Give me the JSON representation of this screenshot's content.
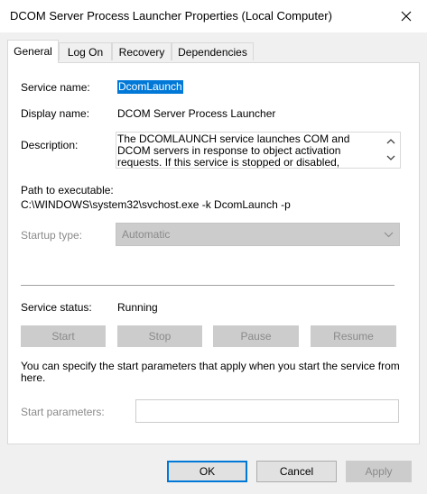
{
  "window": {
    "title": "DCOM Server Process Launcher Properties (Local Computer)",
    "close_glyph": "close-icon"
  },
  "tabs": [
    {
      "label": "General",
      "active": true
    },
    {
      "label": "Log On",
      "active": false
    },
    {
      "label": "Recovery",
      "active": false
    },
    {
      "label": "Dependencies",
      "active": false
    }
  ],
  "general": {
    "service_name_label": "Service name:",
    "service_name": "DcomLaunch",
    "display_name_label": "Display name:",
    "display_name": "DCOM Server Process Launcher",
    "description_label": "Description:",
    "description": "The DCOMLAUNCH service launches COM and DCOM servers in response to object activation requests. If this service is stopped or disabled,",
    "path_label": "Path to executable:",
    "path": "C:\\WINDOWS\\system32\\svchost.exe -k DcomLaunch -p",
    "startup_type_label": "Startup type:",
    "startup_type": "Automatic",
    "service_status_label": "Service status:",
    "service_status": "Running",
    "buttons": {
      "start": "Start",
      "stop": "Stop",
      "pause": "Pause",
      "resume": "Resume"
    },
    "info": "You can specify the start parameters that apply when you start the service from here.",
    "start_params_label": "Start parameters:",
    "start_params_value": ""
  },
  "footer": {
    "ok": "OK",
    "cancel": "Cancel",
    "apply": "Apply"
  },
  "colors": {
    "selection": "#0078d7",
    "disabled_text": "#8a8a8a",
    "panel_bg": "#ffffff",
    "window_bg": "#f0f0f0"
  }
}
